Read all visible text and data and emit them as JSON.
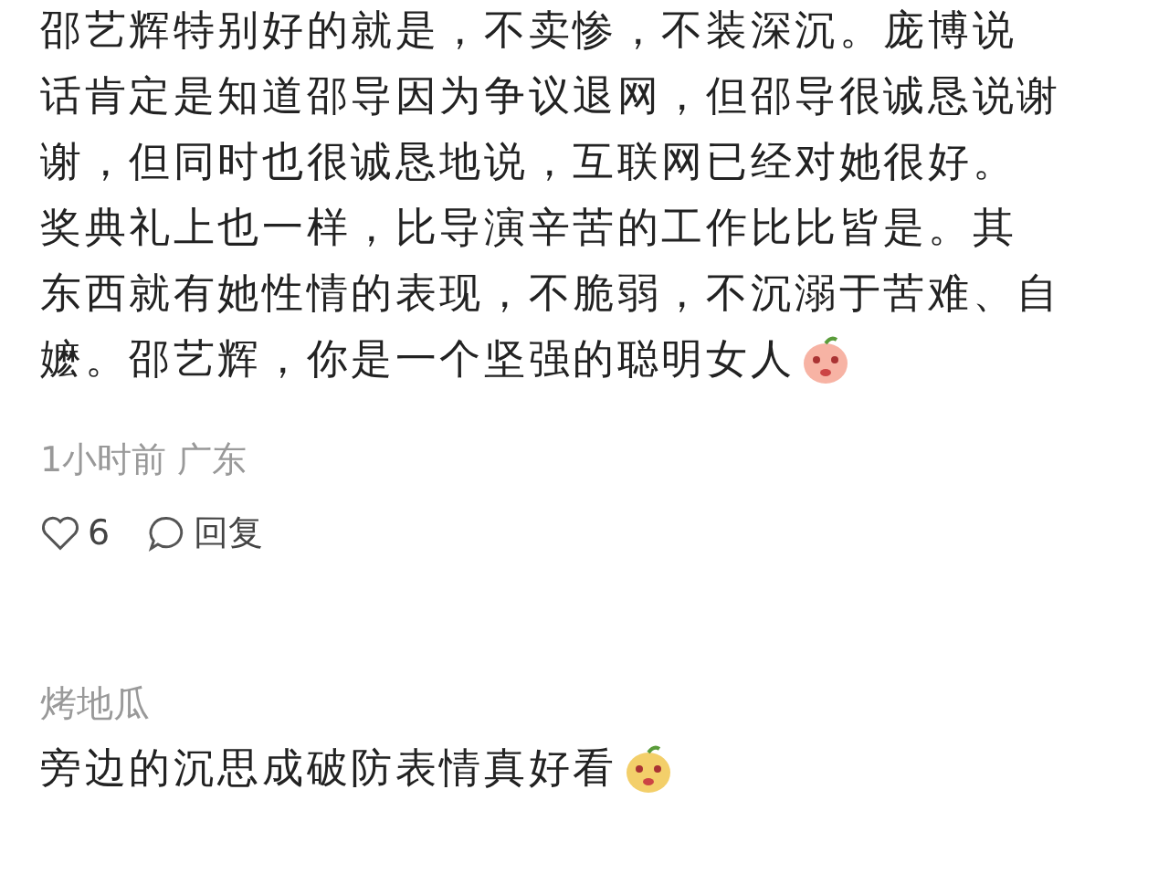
{
  "comments": [
    {
      "lines": [
        "邵艺辉特别好的就是，不卖惨，不装深沉。庞博说",
        "话肯定是知道邵导因为争议退网，但邵导很诚恳说谢",
        "谢，但同时也很诚恳地说，互联网已经对她很好。",
        "奖典礼上也一样，比导演辛苦的工作比比皆是。其",
        "东西就有她性情的表现，不脆弱，不沉溺于苦难、自",
        "嬷。邵艺辉，你是一个坚强的聪明女人"
      ],
      "color": "#f7b3a4",
      "meta": "1小时前 广东",
      "likes": "6",
      "reply": "回复"
    },
    {
      "author": "烤地瓜",
      "lines": [
        "旁边的沉思成破防表情真好看"
      ],
      "color": "#f3cf6a"
    }
  ]
}
